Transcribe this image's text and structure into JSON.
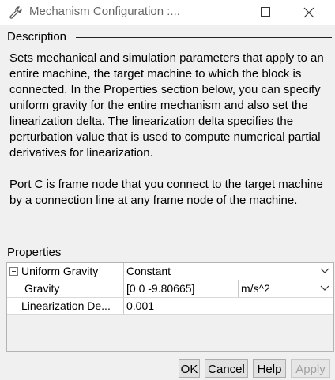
{
  "window": {
    "title": "Mechanism Configuration :...",
    "icon": "wrench-icon",
    "controls": [
      "minimize-icon",
      "maximize-icon",
      "close-icon"
    ]
  },
  "description": {
    "heading": "Description",
    "text": "Sets mechanical and simulation parameters that apply to an entire machine, the target machine to which the block is connected. In the Properties section below, you can specify uniform gravity for the entire mechanism and also set the linearization delta. The linearization delta specifies the perturbation value that is used to compute numerical partial derivatives for linearization.\n\nPort C is frame node that you connect to the target machine by a connection line at any frame node of the machine."
  },
  "properties": {
    "heading": "Properties",
    "rows": [
      {
        "name": "Uniform Gravity",
        "value": "Constant"
      },
      {
        "name": "Gravity",
        "value": "[0 0 -9.80665]",
        "unit": "m/s^2"
      },
      {
        "name": "Linearization De...",
        "value": "0.001"
      }
    ]
  },
  "buttons": {
    "ok": "OK",
    "cancel": "Cancel",
    "help": "Help",
    "apply": "Apply"
  }
}
